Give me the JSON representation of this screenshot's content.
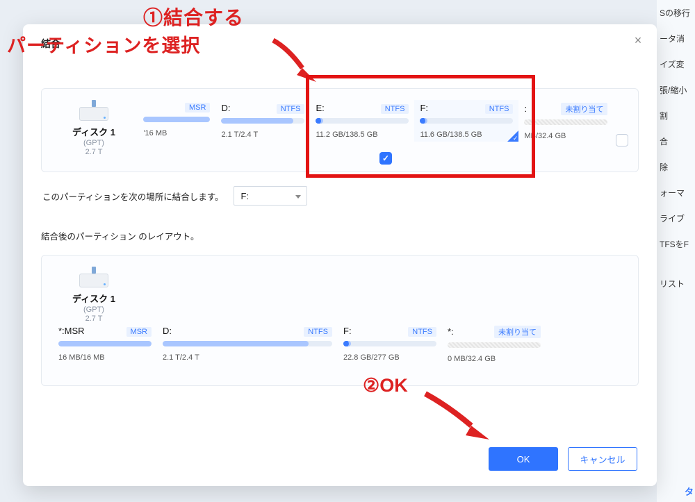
{
  "dialog": {
    "title": "結合",
    "dest_label": "このパーティションを次の場所に結合します。",
    "dest_value": "F:",
    "after_label": "結合後のパーティション のレイアウト。",
    "ok": "OK",
    "cancel": "キャンセル"
  },
  "before": {
    "disk": {
      "name": "ディスク 1",
      "scheme": "(GPT)",
      "size": "2.7 T"
    },
    "parts": [
      {
        "letter": "",
        "fs": "MSR",
        "size": "'16 MB",
        "fill_pct": 100,
        "hatched": false,
        "unalloc": false,
        "knob": false
      },
      {
        "letter": "D:",
        "fs": "NTFS",
        "size": "2.1 T/2.4 T",
        "fill_pct": 86,
        "hatched": false,
        "unalloc": false,
        "knob": false
      },
      {
        "letter": "E:",
        "fs": "NTFS",
        "size": "11.2 GB/138.5 GB",
        "fill_pct": 8,
        "hatched": false,
        "unalloc": false,
        "knob": true
      },
      {
        "letter": "F:",
        "fs": "NTFS",
        "size": "11.6 GB/138.5 GB",
        "fill_pct": 8,
        "hatched": false,
        "unalloc": false,
        "knob": true,
        "selected": true
      },
      {
        "letter": ":",
        "fs": "未割り当て",
        "size": "MB/32.4 GB",
        "fill_pct": 0,
        "hatched": true,
        "unalloc": true,
        "knob": false
      }
    ],
    "center_checked": true
  },
  "after": {
    "disk": {
      "name": "ディスク 1",
      "scheme": "(GPT)",
      "size": "2.7 T"
    },
    "parts": [
      {
        "letter": "*:MSR",
        "fs": "MSR",
        "size": "16 MB/16 MB",
        "fill_pct": 100,
        "hatched": false,
        "unalloc": false,
        "knob": false
      },
      {
        "letter": "D:",
        "fs": "NTFS",
        "size": "2.1 T/2.4 T",
        "fill_pct": 86,
        "hatched": false,
        "unalloc": false,
        "knob": false
      },
      {
        "letter": "F:",
        "fs": "NTFS",
        "size": "22.8 GB/277 GB",
        "fill_pct": 8,
        "hatched": false,
        "unalloc": false,
        "knob": true
      },
      {
        "letter": "*:",
        "fs": "未割り当て",
        "size": "0 MB/32.4 GB",
        "fill_pct": 0,
        "hatched": true,
        "unalloc": true,
        "knob": false
      }
    ]
  },
  "annot": {
    "line1": "①結合する",
    "line2": "パーティションを選択",
    "ok": "②OK"
  },
  "bg_menu": [
    "Sの移行",
    "ータ消",
    "イズ変",
    "張/縮小",
    "割",
    "合",
    "除",
    "ォーマ",
    "ライブ",
    "TFSをF",
    "リスト",
    "タ"
  ]
}
